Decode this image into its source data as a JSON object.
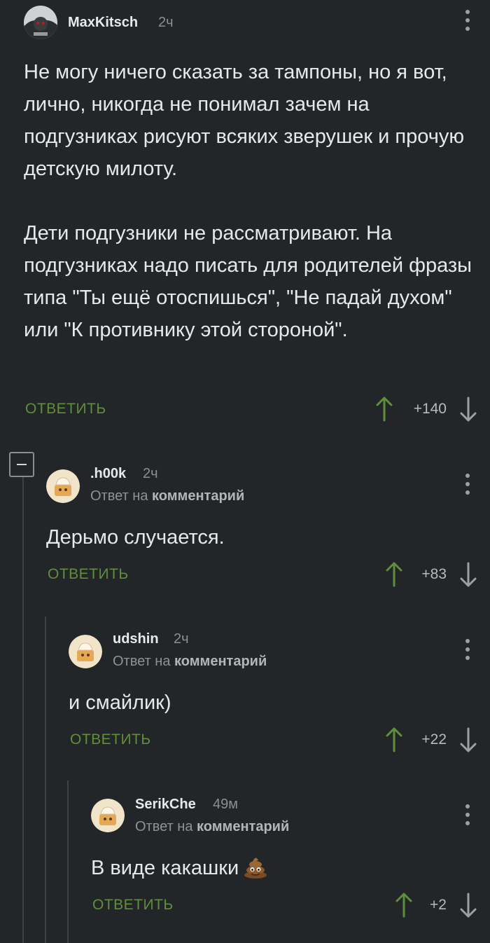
{
  "comments": [
    {
      "username": "MaxKitsch",
      "time": "2ч",
      "text": "Не могу ничего сказать за тампоны, но я вот, лично, никогда не понимал зачем на подгузниках рисуют всяких зверушек и прочую детскую милоту.\n\nДети подгузники не рассматривают. На подгузниках надо писать для родителей фразы типа \"Ты ещё отоспишься\", \"Не падай духом\" или \"К противнику этой стороной\".",
      "reply_label": "ОТВЕТИТЬ",
      "score": "+140"
    },
    {
      "username": ".h00k",
      "time": "2ч",
      "reply_to_prefix": "Ответ на",
      "reply_to_link": "комментарий",
      "text": "Дерьмо случается.",
      "reply_label": "ОТВЕТИТЬ",
      "score": "+83"
    },
    {
      "username": "udshin",
      "time": "2ч",
      "reply_to_prefix": "Ответ на",
      "reply_to_link": "комментарий",
      "text": "и смайлик)",
      "reply_label": "ОТВЕТИТЬ",
      "score": "+22"
    },
    {
      "username": "SerikChe",
      "time": "49м",
      "reply_to_prefix": "Ответ на",
      "reply_to_link": "комментарий",
      "text": "В виде какашки",
      "emoji": "pile-of-poo-emoji",
      "reply_label": "ОТВЕТИТЬ",
      "score": "+2"
    }
  ],
  "colors": {
    "background": "#232628",
    "reply_green": "#5f8f3a",
    "upvote_green": "#5f8f3a",
    "muted_text": "#8c8f91",
    "thread_line": "#3e4245"
  }
}
